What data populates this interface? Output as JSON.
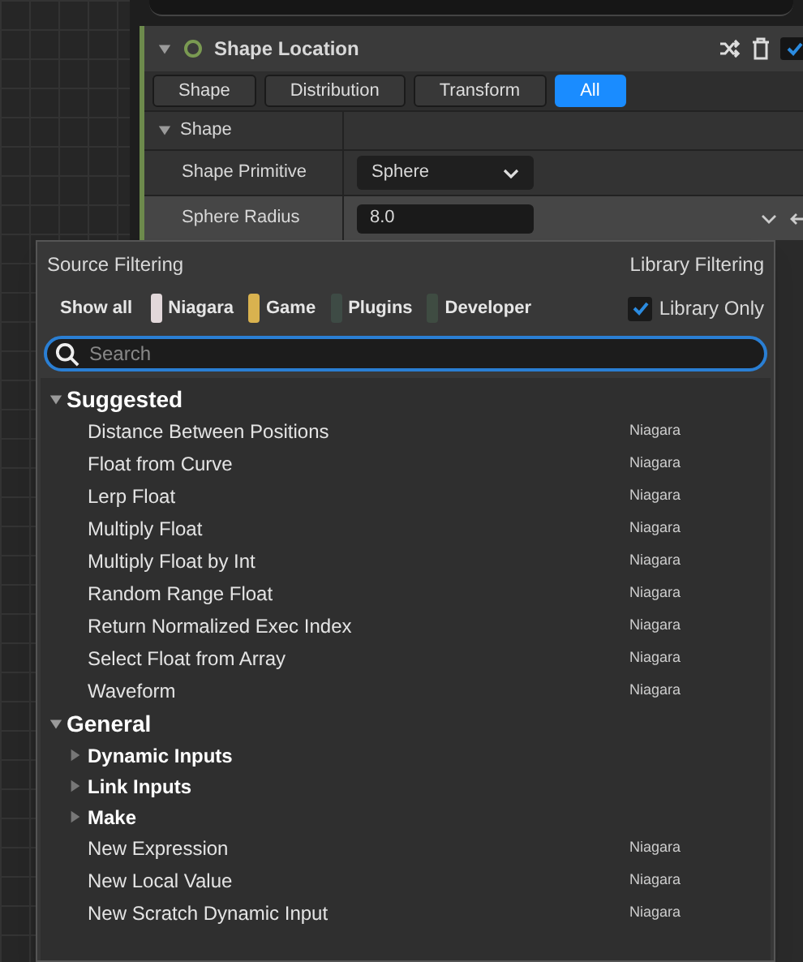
{
  "panel": {
    "title": "Shape Location",
    "enabled": true,
    "checked": true,
    "tabs": [
      {
        "label": "Shape",
        "selected": false
      },
      {
        "label": "Distribution",
        "selected": false
      },
      {
        "label": "Transform",
        "selected": false
      },
      {
        "label": "All",
        "selected": true
      }
    ],
    "section": {
      "label": "Shape",
      "expanded": true
    },
    "properties": [
      {
        "label": "Shape Primitive",
        "kind": "dropdown",
        "value": "Sphere",
        "highlighted": false
      },
      {
        "label": "Sphere Radius",
        "kind": "number",
        "value": "8.0",
        "highlighted": true
      }
    ]
  },
  "popup": {
    "source_filtering": "Source Filtering",
    "library_filtering": "Library Filtering",
    "show_all": "Show all",
    "sources": [
      {
        "label": "Niagara",
        "color": "#e2d8da"
      },
      {
        "label": "Game",
        "color": "#d9b24f"
      },
      {
        "label": "Plugins",
        "color": "#3e4b45"
      },
      {
        "label": "Developer",
        "color": "#3f4c42"
      }
    ],
    "library_only": {
      "label": "Library Only",
      "checked": true
    },
    "search": {
      "placeholder": "Search"
    },
    "groups": [
      {
        "label": "Suggested",
        "expanded": true,
        "children": [
          {
            "kind": "action",
            "label": "Distance Between Positions",
            "source": "Niagara"
          },
          {
            "kind": "action",
            "label": "Float from Curve",
            "source": "Niagara"
          },
          {
            "kind": "action",
            "label": "Lerp Float",
            "source": "Niagara"
          },
          {
            "kind": "action",
            "label": "Multiply Float",
            "source": "Niagara"
          },
          {
            "kind": "action",
            "label": "Multiply Float by Int",
            "source": "Niagara"
          },
          {
            "kind": "action",
            "label": "Random Range Float",
            "source": "Niagara"
          },
          {
            "kind": "action",
            "label": "Return Normalized Exec Index",
            "source": "Niagara"
          },
          {
            "kind": "action",
            "label": "Select Float from Array",
            "source": "Niagara"
          },
          {
            "kind": "action",
            "label": "Waveform",
            "source": "Niagara"
          }
        ]
      },
      {
        "label": "General",
        "expanded": true,
        "children": [
          {
            "kind": "category",
            "label": "Dynamic Inputs",
            "expanded": false
          },
          {
            "kind": "category",
            "label": "Link Inputs",
            "expanded": false
          },
          {
            "kind": "category",
            "label": "Make",
            "expanded": false
          },
          {
            "kind": "action",
            "label": "New Expression",
            "source": "Niagara"
          },
          {
            "kind": "action",
            "label": "New Local Value",
            "source": "Niagara"
          },
          {
            "kind": "action",
            "label": "New Scratch Dynamic Input",
            "source": "Niagara"
          }
        ]
      }
    ]
  }
}
